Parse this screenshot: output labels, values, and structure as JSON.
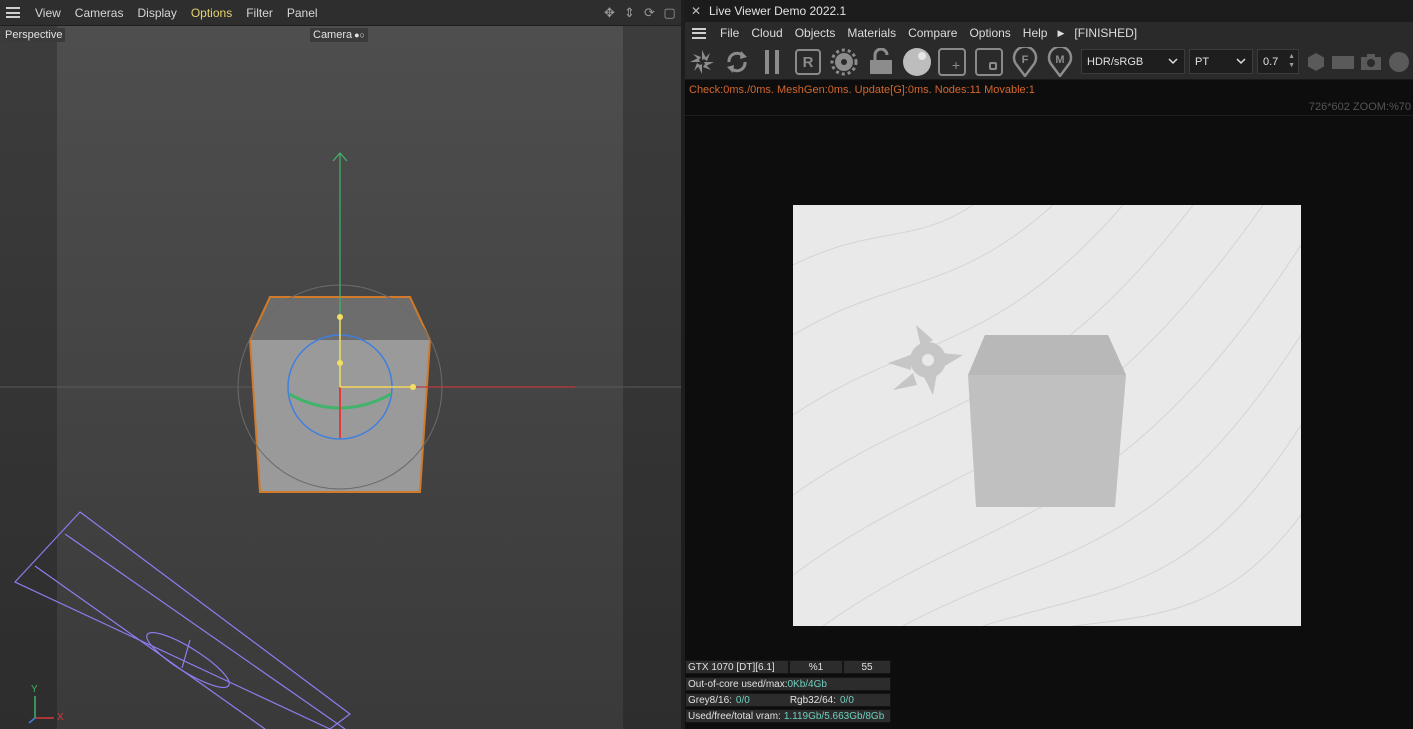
{
  "left": {
    "menu": [
      "View",
      "Cameras",
      "Display",
      "Options",
      "Filter",
      "Panel"
    ],
    "viewport_label": "Perspective",
    "camera_label": "Camera",
    "axis_x": "X",
    "axis_y": "Y",
    "colors": {
      "y_axis": "#3fb46a",
      "x_axis": "#d23b3b",
      "selection": "#d07a2a",
      "rotation_ring": "#3f7fe0",
      "camera_wire": "#8f7cf0",
      "handle": "#f4de62"
    }
  },
  "viewer": {
    "title": "Live Viewer Demo 2022.1",
    "menu": [
      "File",
      "Cloud",
      "Objects",
      "Materials",
      "Compare",
      "Options",
      "Help"
    ],
    "state": "[FINISHED]",
    "toolbar_icons": [
      "octane-logo-icon",
      "refresh-icon",
      "pause-icon",
      "r-icon",
      "gear-icon",
      "unlock-icon",
      "sphere-icon",
      "add-region-icon",
      "focus-icon",
      "f-pin-icon",
      "m-pin-icon"
    ],
    "colorspace": "HDR/sRGB",
    "kernel": "PT",
    "value": "0.7",
    "status": "Check:0ms./0ms. MeshGen:0ms. Update[G]:0ms. Nodes:11 Movable:1",
    "zoom": "726*602 ZOOM:%70",
    "stats": {
      "gpu": "GTX 1070 [DT][6.1]",
      "percent": "%1",
      "num": "55",
      "ooc_label": "Out-of-core used/max:",
      "ooc_value": "0Kb/4Gb",
      "grey_label": "Grey8/16:",
      "grey_value": "0/0",
      "rgb_label": "Rgb32/64:",
      "rgb_value": "0/0",
      "vram_label": "Used/free/total vram:",
      "vram_value": "1.119Gb/5.663Gb/8Gb"
    }
  }
}
